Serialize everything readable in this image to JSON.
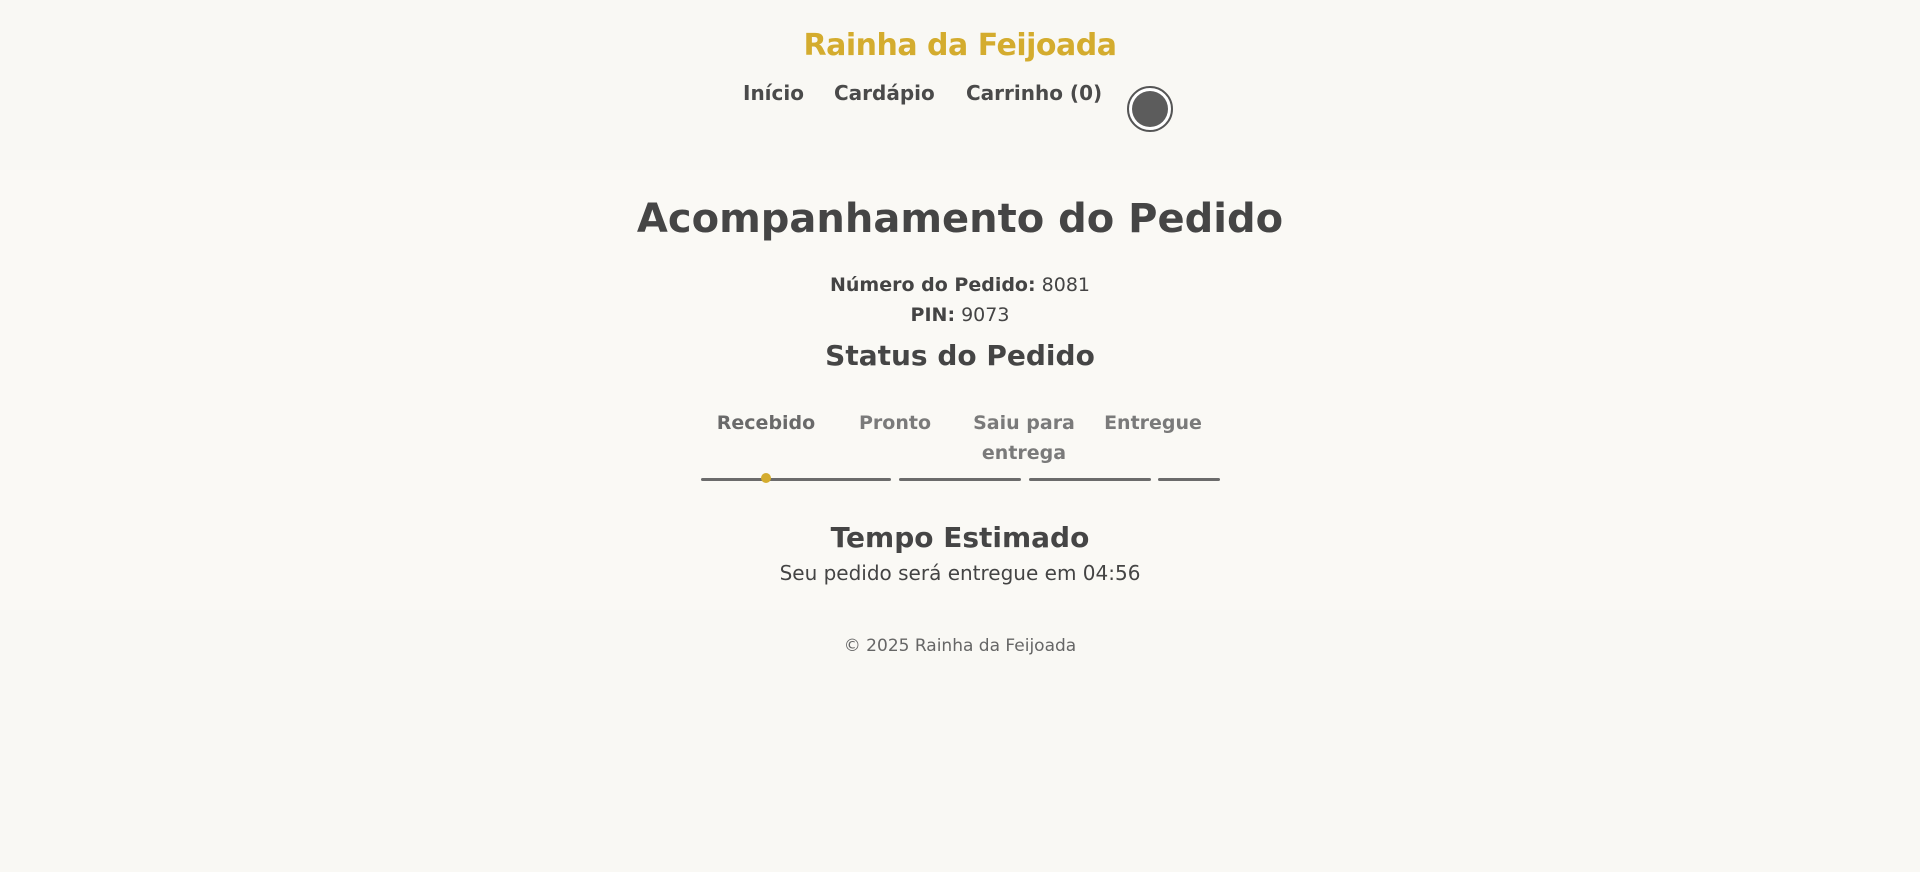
{
  "header": {
    "brand": "Rainha da Feijoada",
    "nav": [
      {
        "label": "Início"
      },
      {
        "label": "Cardápio"
      },
      {
        "label": "Carrinho (0)"
      }
    ]
  },
  "main": {
    "title": "Acompanhamento do Pedido",
    "order_number_label": "Número do Pedido:",
    "order_number_value": "8081",
    "pin_label": "PIN:",
    "pin_value": "9073",
    "status_heading": "Status do Pedido",
    "steps": [
      {
        "label": "Recebido",
        "active": true
      },
      {
        "label": "Pronto",
        "active": false
      },
      {
        "label": "Saiu para entrega",
        "active": false
      },
      {
        "label": "Entregue",
        "active": false
      }
    ],
    "current_step": 1,
    "eta_heading": "Tempo Estimado",
    "eta_text": "Seu pedido será entregue em 04:56"
  },
  "footer": {
    "copyright": "© 2025 Rainha da Feijoada"
  },
  "colors": {
    "accent": "#d4ac2e",
    "text": "#444444",
    "background": "#f9f8f4"
  }
}
